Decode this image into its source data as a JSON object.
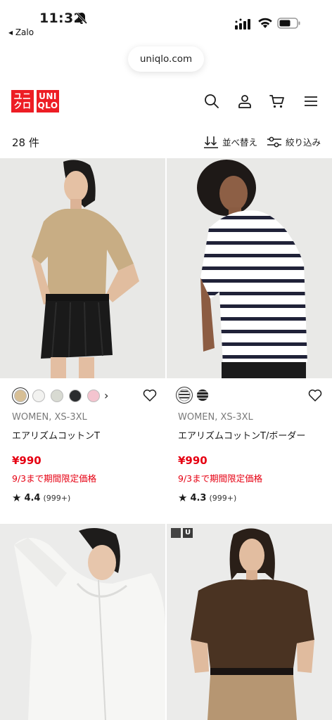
{
  "status_bar": {
    "time": "11:32",
    "back_label": "◂ Zalo"
  },
  "browser": {
    "url": "uniqlo.com"
  },
  "header": {
    "logo_top": "ユニ",
    "logo_top2": "UNI",
    "logo_bottom": "クロ",
    "logo_bottom2": "QLO"
  },
  "toolbar": {
    "count": "28 件",
    "sort_label": "並べ替え",
    "filter_label": "絞り込み"
  },
  "products": [
    {
      "category": "WOMEN, XS-3XL",
      "name": "エアリズムコットンT",
      "price": "¥990",
      "promo": "9/3まで期間限定価格",
      "rating": "4.4",
      "reviews": "(999+)",
      "swatch_colors": [
        "#d7bf95",
        "#f2f2f0",
        "#d8dad2",
        "#2a2c2e",
        "#f4c4cf"
      ],
      "more": "›"
    },
    {
      "category": "WOMEN, XS-3XL",
      "name": "エアリズムコットンT/ボーダー",
      "price": "¥990",
      "promo": "9/3まで期間限定価格",
      "rating": "4.3",
      "reviews": "(999+)",
      "swatch_colors": [
        "stripe-light",
        "stripe-dark"
      ]
    }
  ],
  "badge": {
    "text": "U"
  },
  "colors": {
    "accent": "#ed1d24",
    "price_red": "#e60012"
  }
}
